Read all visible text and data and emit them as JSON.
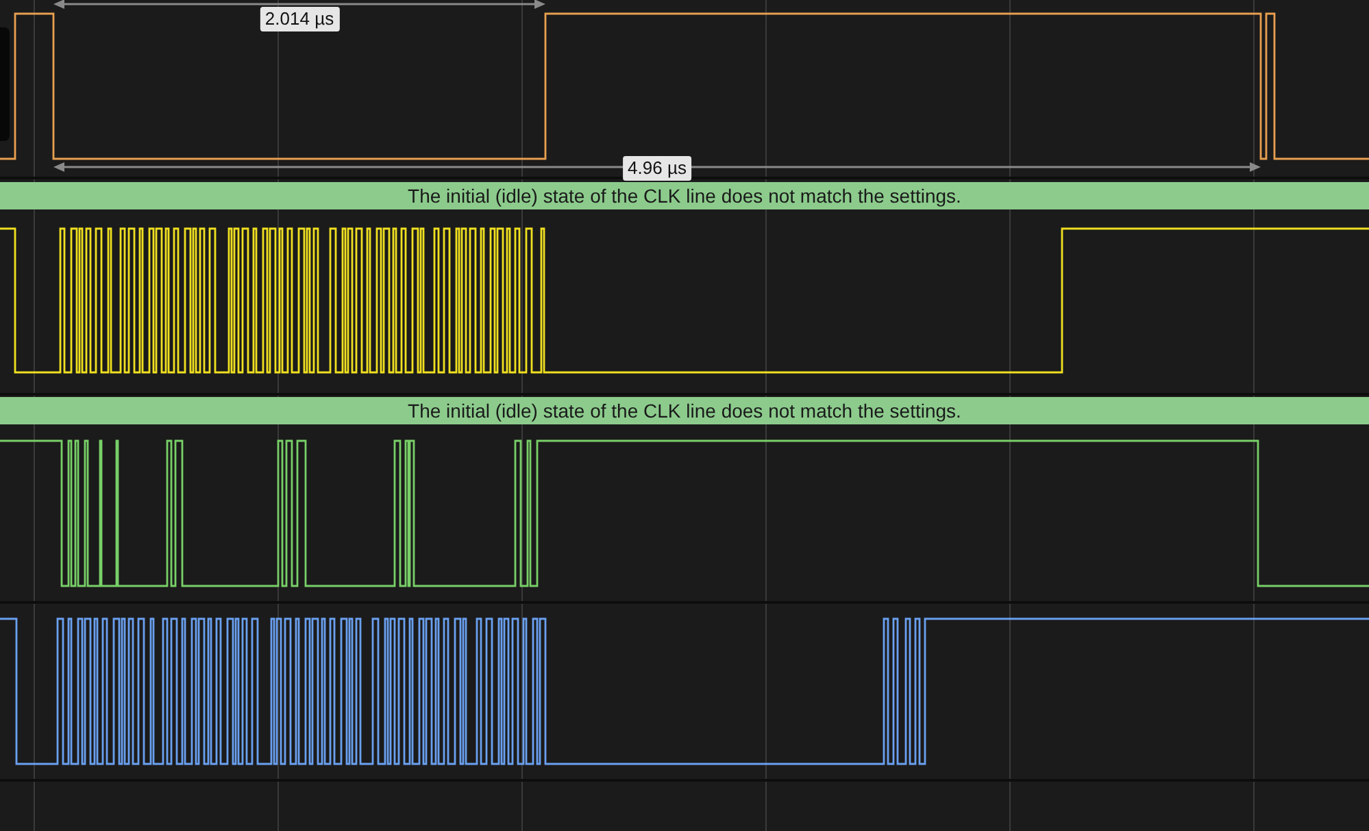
{
  "measurements": [
    {
      "label": "2.014 µs",
      "kind": "top"
    },
    {
      "label": "4.96 µs",
      "kind": "bottom"
    }
  ],
  "banners": [
    {
      "text": "The initial (idle) state of the CLK line does not match the settings."
    },
    {
      "text": "The initial (idle) state of the CLK line does not match the settings."
    }
  ],
  "channels": [
    {
      "color": "#e8a050"
    },
    {
      "color": "#f0e020"
    },
    {
      "color": "#78d068"
    },
    {
      "color": "#6aa0f0"
    }
  ]
}
